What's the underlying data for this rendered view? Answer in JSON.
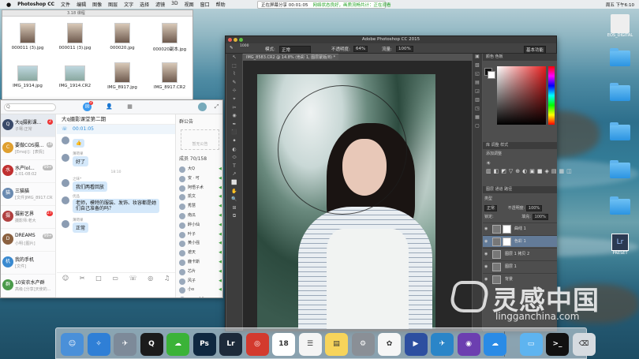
{
  "menubar": {
    "app": "Photoshop CC",
    "items": [
      "文件",
      "编辑",
      "图像",
      "图层",
      "文字",
      "选择",
      "滤镜",
      "3D",
      "视图",
      "窗口",
      "帮助"
    ],
    "clock": "周五 下午6:10"
  },
  "share_bar": {
    "status": "正在屏幕分享 00:01:05",
    "network": "网络状态良好，画质流畅共计：正在观看"
  },
  "finder": {
    "title": "3.18 课程",
    "files": [
      {
        "name": "000011 (3).jpg",
        "orient": "portrait"
      },
      {
        "name": "000011 (3).jpg",
        "orient": "portrait"
      },
      {
        "name": "000020.jpg",
        "orient": "portrait"
      },
      {
        "name": "000020副本.jpg",
        "orient": "portrait"
      },
      {
        "name": "IMG_1914.jpg",
        "orient": "landscape"
      },
      {
        "name": "IMG_1914.CR2",
        "orient": "landscape"
      },
      {
        "name": "IMG_8917.jpg",
        "orient": "portrait"
      },
      {
        "name": "IMG_8917.CR2",
        "orient": "portrait"
      }
    ]
  },
  "qq": {
    "search_placeholder": "Q",
    "msg_badge": "2",
    "contacts": [
      {
        "name": "大q摄影课...",
        "preview": "子骞:正常",
        "badge": "2",
        "avatar": "Q",
        "color": "#3a4a6a"
      },
      {
        "name": "要做COS摄...",
        "preview": "[Emoji]：[表情]",
        "badge": "18",
        "avatar": "C",
        "color": "#e0a030"
      },
      {
        "name": "水产lol...",
        "preview": "1:01-08:02",
        "badge": "99+",
        "avatar": "水",
        "color": "#c03030"
      },
      {
        "name": "三猫猫",
        "preview": "[文件]IMG_8917.CR2",
        "badge": "",
        "avatar": "猫",
        "color": "#6a8ab0"
      },
      {
        "name": "摄影艺界",
        "preview": "摄影师:老大",
        "badge": "27",
        "avatar": "摄",
        "color": "#b04040"
      },
      {
        "name": "DREAMS",
        "preview": "小明:[图片]",
        "badge": "99+",
        "avatar": "D",
        "color": "#8a6040"
      },
      {
        "name": "我的手机",
        "preview": "[文件]",
        "badge": "",
        "avatar": "机",
        "color": "#3a8ad0"
      },
      {
        "name": "10安农水产群",
        "preview": "高级:[分享]天使的...",
        "badge": "",
        "avatar": "群",
        "color": "#4a9a4a"
      }
    ],
    "chat": {
      "title": "大q摄影课堂第二期",
      "call_time": "00:01:05",
      "messages": [
        {
          "sender": "",
          "text": "👍"
        },
        {
          "sender": "薄荷果",
          "text": "好了"
        },
        {
          "sender": "之味*",
          "text": "我们两看回放"
        },
        {
          "sender": "优品",
          "text": "老师，模特的服装、发饰、妆容都是她们自己准备的吗？"
        },
        {
          "sender": "薄荷果",
          "text": "正常"
        }
      ],
      "timestamp": "18:10",
      "tools": [
        "☺",
        "✂",
        "□",
        "▭",
        "☏",
        "◎",
        "♫"
      ]
    },
    "group": {
      "notice_title": "群公告",
      "notice_empty": "暂无公告",
      "members_label": "成员 70/158",
      "members": [
        "大Q",
        "安 · 可",
        "阿悟子术",
        "凯文",
        "秀慧",
        "南瓜",
        "醉小仙",
        "叶子",
        "黄小强",
        "遮天",
        "鹿卡斯",
        "芯片",
        "风子",
        "小o",
        "new shit",
        "查查儿SDA8"
      ]
    }
  },
  "photoshop": {
    "title": "Adobe Photoshop CC 2015",
    "doc_tab": "IMG_8583.CR2 @ 14.8% (色彩 1, 图层蒙版/8) *",
    "options": {
      "mode_label": "模式:",
      "mode": "正常",
      "opacity_label": "不透明度:",
      "opacity": "64%",
      "flow_label": "流量:",
      "flow": "100%",
      "workspace": "基本功能",
      "brush_size": "1000"
    },
    "tools": [
      "↖",
      "⬚",
      "⌇",
      "✎",
      "⊹",
      "⌖",
      "✂",
      "◉",
      "✒",
      "⬛",
      "⚫",
      "◐",
      "⬭",
      "T",
      "↗",
      "⬜",
      "✋",
      "🔍",
      "⊞",
      "⧉"
    ],
    "color_tabs": "颜色   色板",
    "adj_tabs": "库   调整   样式",
    "adj_title": "添加调整",
    "adj_icons": [
      "☀",
      "▥",
      "◧",
      "◩",
      "▽",
      "⊕",
      "◐",
      "▣",
      "■",
      "◈",
      "▤",
      "▦",
      "◫"
    ],
    "layer_tabs": "图层   通道   路径",
    "kind_label": "类型",
    "blend": "正常",
    "opacity_label": "不透明度:",
    "opacity": "100%",
    "lock_label": "锁定:",
    "fill_label": "填充:",
    "fill": "100%",
    "layers": [
      {
        "name": "曲线 1",
        "selected": false
      },
      {
        "name": "色彩 1",
        "selected": true
      },
      {
        "name": "图层 1 拷贝 2",
        "selected": false
      },
      {
        "name": "图层 1",
        "selected": false
      },
      {
        "name": "背景",
        "selected": false
      }
    ]
  },
  "desktop_icons": [
    {
      "label": "EOS_DIGITAL",
      "type": "drive"
    },
    {
      "label": "",
      "type": "folder"
    },
    {
      "label": "",
      "type": "folder"
    },
    {
      "label": "",
      "type": "folder"
    },
    {
      "label": "",
      "type": "folder"
    },
    {
      "label": "",
      "type": "folder"
    },
    {
      "label": "PRESET",
      "type": "lr"
    }
  ],
  "dock": [
    {
      "name": "finder",
      "color": "#4a90d9",
      "glyph": "☺"
    },
    {
      "name": "safari",
      "color": "#2f7fd6",
      "glyph": "✧"
    },
    {
      "name": "launchpad",
      "color": "#7d8a99",
      "glyph": "✈"
    },
    {
      "name": "qq",
      "color": "#1b1b1b",
      "glyph": "Q"
    },
    {
      "name": "wechat",
      "color": "#3bb338",
      "glyph": "☁"
    },
    {
      "name": "photoshop",
      "color": "#0f2840",
      "glyph": "Ps"
    },
    {
      "name": "lightroom",
      "color": "#1d2a3a",
      "glyph": "Lr"
    },
    {
      "name": "netease-music",
      "color": "#d33a2e",
      "glyph": "◎"
    },
    {
      "name": "calendar",
      "color": "#ffffff",
      "glyph": "18"
    },
    {
      "name": "reminders",
      "color": "#f4f4f4",
      "glyph": "☰"
    },
    {
      "name": "notes",
      "color": "#f7d45b",
      "glyph": "▤"
    },
    {
      "name": "system-prefs",
      "color": "#8a8f96",
      "glyph": "⚙"
    },
    {
      "name": "photos",
      "color": "#f6f6f6",
      "glyph": "✿"
    },
    {
      "name": "movie",
      "color": "#2d4fa0",
      "glyph": "▶"
    },
    {
      "name": "xcode",
      "color": "#2a85c8",
      "glyph": "✈"
    },
    {
      "name": "player",
      "color": "#6c3fb0",
      "glyph": "◉"
    },
    {
      "name": "baidu-cloud",
      "color": "#2a8be6",
      "glyph": "☁"
    },
    {
      "name": "folder",
      "color": "#5eb4f0",
      "glyph": "▭"
    },
    {
      "name": "terminal",
      "color": "#111111",
      "glyph": ">_"
    },
    {
      "name": "trash",
      "color": "#d6dbe0",
      "glyph": "⌫"
    }
  ],
  "watermark": {
    "cn": "灵感中国",
    "en": "lingganchina.com"
  }
}
